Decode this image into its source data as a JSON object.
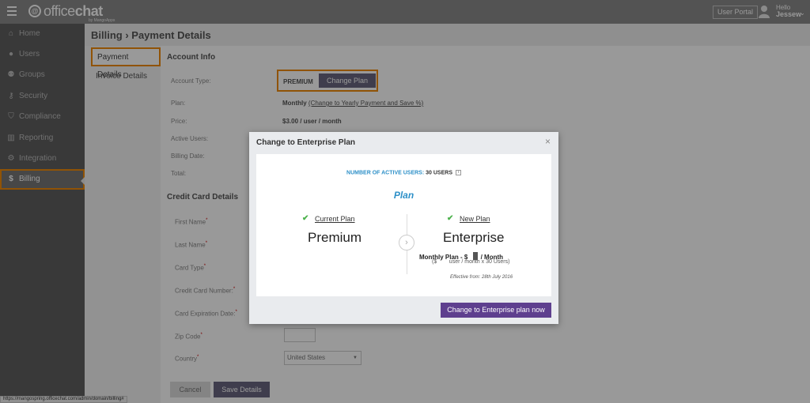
{
  "app": {
    "logo_text_light": "office",
    "logo_text_bold": "chat",
    "logo_sub": "by MangoApps",
    "user_portal_label": "User Portal",
    "greeting": "Hello",
    "username": "Jessew"
  },
  "sidebar": {
    "items": [
      {
        "label": "Home",
        "icon": "home-icon"
      },
      {
        "label": "Users",
        "icon": "user-icon"
      },
      {
        "label": "Groups",
        "icon": "groups-icon"
      },
      {
        "label": "Security",
        "icon": "key-icon"
      },
      {
        "label": "Compliance",
        "icon": "shield-icon"
      },
      {
        "label": "Reporting",
        "icon": "bar-chart-icon"
      },
      {
        "label": "Integration",
        "icon": "gear-icon"
      },
      {
        "label": "Billing",
        "icon": "dollar-icon",
        "active": true
      }
    ]
  },
  "page": {
    "title": "Billing › Payment Details",
    "subnav": [
      "Payment Details",
      "Invoice Details"
    ]
  },
  "account_info": {
    "title": "Account Info",
    "account_type_label": "Account Type:",
    "account_type_value": "PREMIUM",
    "change_plan_label": "Change Plan",
    "plan_label": "Plan:",
    "plan_value": "Monthly",
    "plan_link": "(Change to Yearly Payment and Save %)",
    "price_label": "Price:",
    "price_value": "$3.00 / user / month",
    "active_users_label": "Active Users:",
    "billing_date_label": "Billing Date:",
    "total_label": "Total:"
  },
  "credit_card": {
    "title": "Credit Card Details",
    "first_name_label": "First Name",
    "last_name_label": "Last Name",
    "card_type_label": "Card Type",
    "card_number_label": "Credit Card Number:",
    "expiration_label": "Card Expiration Date:",
    "zip_label": "Zip Code",
    "country_label": "Country",
    "required_mark": "*",
    "country_value": "United States",
    "cancel_label": "Cancel",
    "save_label": "Save Details"
  },
  "modal": {
    "title": "Change to Enterprise Plan",
    "close": "×",
    "active_users_label": "NUMBER OF ACTIVE USERS:",
    "active_users_value": "30 USERS",
    "plan_heading": "Plan",
    "current_plan_label": "Current Plan",
    "current_plan_name": "Premium",
    "new_plan_label": "New Plan",
    "new_plan_name": "Enterprise",
    "pricing_prefix": "Monthly Plan - $",
    "pricing_suffix": "/ Month",
    "pricing_sub_prefix": "($",
    "pricing_sub_suffix": "user / month x 30 Users)",
    "effective": "Effective from: 28th July 2016",
    "confirm_label": "Change to Enterprise plan now"
  },
  "status_url": "https://mangospring.officechat.com/admin/domain/billing#",
  "colors": {
    "accent_highlight": "#f08a0b",
    "primary_button": "#5e3f8e",
    "link_blue": "#2e90c8",
    "check_green": "#4db24d"
  }
}
